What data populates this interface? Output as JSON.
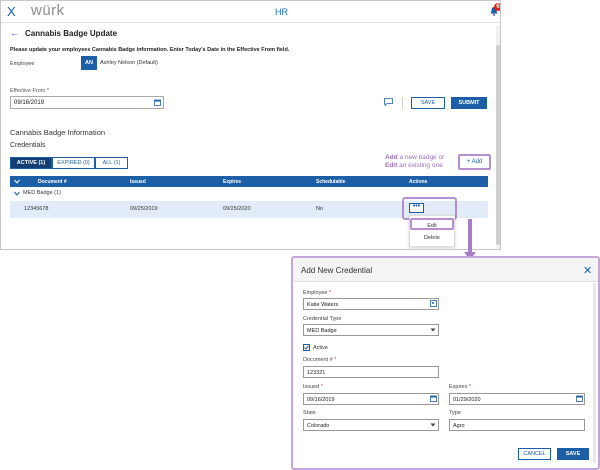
{
  "topbar": {
    "close_glyph": "X",
    "logo": "würk",
    "module": "HR",
    "notification_count": "6"
  },
  "page": {
    "title": "Cannabis Badge Update",
    "instructions": "Please update your employees Cannabis Badge information.  Enter Today's Date in the Effective From field.",
    "employee_label": "Employee",
    "employee_initials": "AN",
    "employee_name": "Ashley Nelson (Default)",
    "effective_from_label": "Effective From *",
    "effective_from_value": "09/16/2019",
    "save_label": "SAVE",
    "submit_label": "SUBMIT",
    "section_title": "Cannabis Badge Information",
    "credentials_title": "Credentials",
    "tabs": [
      {
        "label": "ACTIVE (1)",
        "active": true
      },
      {
        "label": "EXPIRED (0)",
        "active": false
      },
      {
        "label": "ALL (1)",
        "active": false
      }
    ],
    "callout_line1_bold": "Add",
    "callout_line1_rest": " a new badge or",
    "callout_line2_bold": "Edit",
    "callout_line2_rest": " an existing one",
    "add_label": "+ Add",
    "table": {
      "headers": [
        "Document #",
        "Issued",
        "Expires",
        "Schedulable",
        "Actions"
      ],
      "group_label": "MED Badge (1)",
      "rows": [
        {
          "document": "12345678",
          "issued": "09/25/2019",
          "expires": "09/25/2020",
          "schedulable": "No"
        }
      ]
    },
    "actions_button": "•••",
    "menu": {
      "edit": "Edit",
      "delete": "Delete"
    }
  },
  "modal": {
    "title": "Add New Credential",
    "employee_label": "Employee",
    "employee_value": "Katie Waters",
    "credential_type_label": "Credential Type",
    "credential_type_value": "MED Badge",
    "active_label": "Active",
    "active_checked": true,
    "document_label": "Document #",
    "document_value": "123321",
    "issued_label": "Issued",
    "issued_value": "09/16/2019",
    "expires_label": "Expires",
    "expires_value": "01/29/2020",
    "state_label": "State",
    "state_value": "Colorado",
    "type_label": "Type",
    "type_value": "Agro",
    "cancel_label": "CANCEL",
    "save_label": "SAVE"
  },
  "colors": {
    "primary": "#1d5fa6",
    "dark_tab": "#123e73",
    "highlight": "#b58fd1",
    "row_selected": "#e1ecf8",
    "required": "#c0392b"
  }
}
